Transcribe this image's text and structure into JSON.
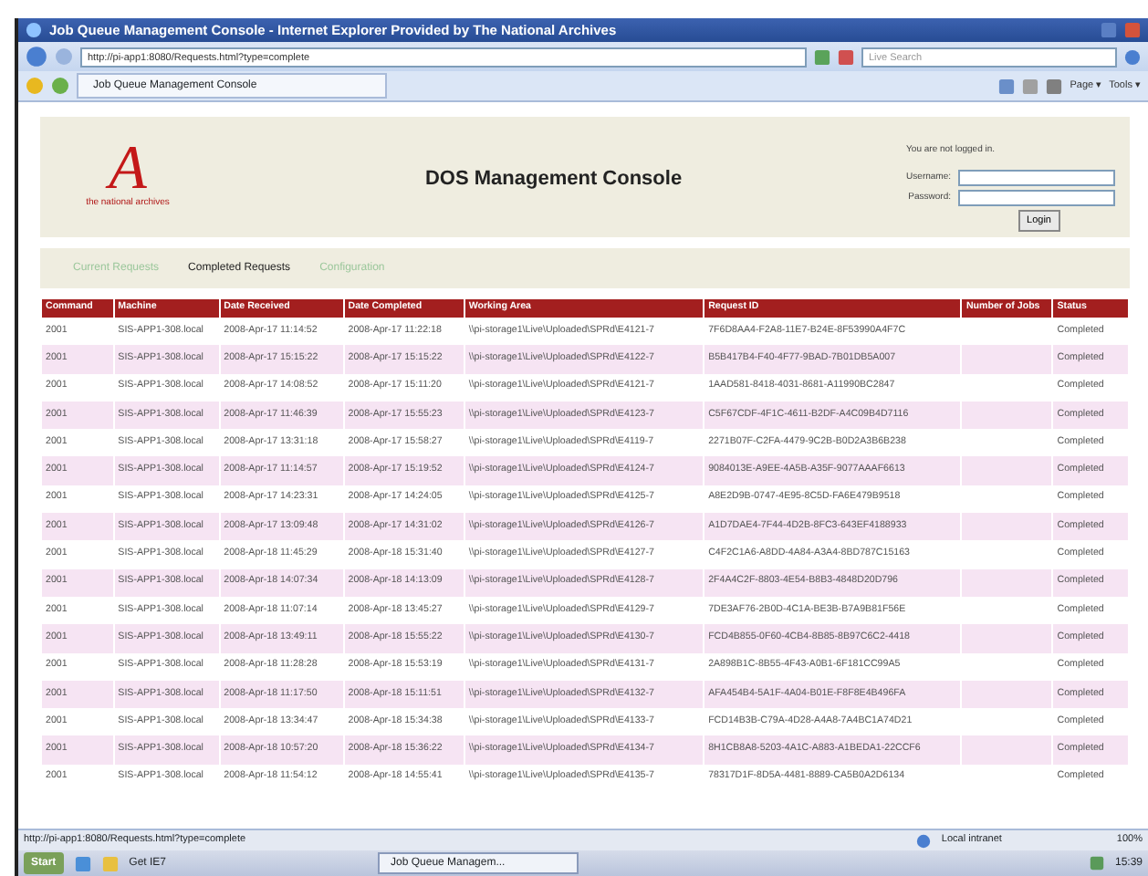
{
  "window": {
    "title": "Job Queue Management Console - Internet Explorer Provided by The National Archives"
  },
  "address_bar": {
    "url": "http://pi-app1:8080/Requests.html?type=complete",
    "search_placeholder": "Live Search"
  },
  "browser_tab": {
    "title": "Job Queue Management Console"
  },
  "command_bar": [
    "Page ▾",
    "Tools ▾"
  ],
  "header": {
    "logo_letter": "A",
    "logo_caption": "the national archives",
    "title": "DOS Management Console",
    "login": {
      "note": "You are not logged in.",
      "username_label": "Username:",
      "password_label": "Password:",
      "button": "Login"
    }
  },
  "nav": [
    {
      "label": "Current Requests",
      "selected": false
    },
    {
      "label": "Completed Requests",
      "selected": true
    },
    {
      "label": "Configuration",
      "selected": false
    }
  ],
  "table": {
    "columns": [
      "Command",
      "Machine",
      "Date Received",
      "Date Completed",
      "Working Area",
      "Request ID",
      "Number of Jobs",
      "Status"
    ],
    "rows": [
      [
        "2001",
        "SIS-APP1-308.local",
        "2008-Apr-17 11:14:52",
        "2008-Apr-17 11:22:18",
        "\\\\pi-storage1\\Live\\Uploaded\\SPRd\\E4121-7",
        "7F6D8AA4-F2A8-11E7-B24E-8F53990A4F7C",
        "",
        "Completed"
      ],
      [
        "2001",
        "SIS-APP1-308.local",
        "2008-Apr-17 15:15:22",
        "2008-Apr-17 15:15:22",
        "\\\\pi-storage1\\Live\\Uploaded\\SPRd\\E4122-7",
        "B5B417B4-F40-4F77-9BAD-7B01DB5A007",
        "",
        "Completed"
      ],
      [
        "2001",
        "SIS-APP1-308.local",
        "2008-Apr-17 14:08:52",
        "2008-Apr-17 15:11:20",
        "\\\\pi-storage1\\Live\\Uploaded\\SPRd\\E4121-7",
        "1AAD581-8418-4031-8681-A11990BC2847",
        "",
        "Completed"
      ],
      [
        "2001",
        "SIS-APP1-308.local",
        "2008-Apr-17 11:46:39",
        "2008-Apr-17 15:55:23",
        "\\\\pi-storage1\\Live\\Uploaded\\SPRd\\E4123-7",
        "C5F67CDF-4F1C-4611-B2DF-A4C09B4D7116",
        "",
        "Completed"
      ],
      [
        "2001",
        "SIS-APP1-308.local",
        "2008-Apr-17 13:31:18",
        "2008-Apr-17 15:58:27",
        "\\\\pi-storage1\\Live\\Uploaded\\SPRd\\E4119-7",
        "2271B07F-C2FA-4479-9C2B-B0D2A3B6B238",
        "",
        "Completed"
      ],
      [
        "2001",
        "SIS-APP1-308.local",
        "2008-Apr-17 11:14:57",
        "2008-Apr-17 15:19:52",
        "\\\\pi-storage1\\Live\\Uploaded\\SPRd\\E4124-7",
        "9084013E-A9EE-4A5B-A35F-9077AAAF6613",
        "",
        "Completed"
      ],
      [
        "2001",
        "SIS-APP1-308.local",
        "2008-Apr-17 14:23:31",
        "2008-Apr-17 14:24:05",
        "\\\\pi-storage1\\Live\\Uploaded\\SPRd\\E4125-7",
        "A8E2D9B-0747-4E95-8C5D-FA6E479B9518",
        "",
        "Completed"
      ],
      [
        "2001",
        "SIS-APP1-308.local",
        "2008-Apr-17 13:09:48",
        "2008-Apr-17 14:31:02",
        "\\\\pi-storage1\\Live\\Uploaded\\SPRd\\E4126-7",
        "A1D7DAE4-7F44-4D2B-8FC3-643EF4188933",
        "",
        "Completed"
      ],
      [
        "2001",
        "SIS-APP1-308.local",
        "2008-Apr-18 11:45:29",
        "2008-Apr-18 15:31:40",
        "\\\\pi-storage1\\Live\\Uploaded\\SPRd\\E4127-7",
        "C4F2C1A6-A8DD-4A84-A3A4-8BD787C15163",
        "",
        "Completed"
      ],
      [
        "2001",
        "SIS-APP1-308.local",
        "2008-Apr-18 14:07:34",
        "2008-Apr-18 14:13:09",
        "\\\\pi-storage1\\Live\\Uploaded\\SPRd\\E4128-7",
        "2F4A4C2F-8803-4E54-B8B3-4848D20D796",
        "",
        "Completed"
      ],
      [
        "2001",
        "SIS-APP1-308.local",
        "2008-Apr-18 11:07:14",
        "2008-Apr-18 13:45:27",
        "\\\\pi-storage1\\Live\\Uploaded\\SPRd\\E4129-7",
        "7DE3AF76-2B0D-4C1A-BE3B-B7A9B81F56E",
        "",
        "Completed"
      ],
      [
        "2001",
        "SIS-APP1-308.local",
        "2008-Apr-18 13:49:11",
        "2008-Apr-18 15:55:22",
        "\\\\pi-storage1\\Live\\Uploaded\\SPRd\\E4130-7",
        "FCD4B855-0F60-4CB4-8B85-8B97C6C2-4418",
        "",
        "Completed"
      ],
      [
        "2001",
        "SIS-APP1-308.local",
        "2008-Apr-18 11:28:28",
        "2008-Apr-18 15:53:19",
        "\\\\pi-storage1\\Live\\Uploaded\\SPRd\\E4131-7",
        "2A898B1C-8B55-4F43-A0B1-6F181CC99A5",
        "",
        "Completed"
      ],
      [
        "2001",
        "SIS-APP1-308.local",
        "2008-Apr-18 11:17:50",
        "2008-Apr-18 15:11:51",
        "\\\\pi-storage1\\Live\\Uploaded\\SPRd\\E4132-7",
        "AFA454B4-5A1F-4A04-B01E-F8F8E4B496FA",
        "",
        "Completed"
      ],
      [
        "2001",
        "SIS-APP1-308.local",
        "2008-Apr-18 13:34:47",
        "2008-Apr-18 15:34:38",
        "\\\\pi-storage1\\Live\\Uploaded\\SPRd\\E4133-7",
        "FCD14B3B-C79A-4D28-A4A8-7A4BC1A74D21",
        "",
        "Completed"
      ],
      [
        "2001",
        "SIS-APP1-308.local",
        "2008-Apr-18 10:57:20",
        "2008-Apr-18 15:36:22",
        "\\\\pi-storage1\\Live\\Uploaded\\SPRd\\E4134-7",
        "8H1CB8A8-5203-4A1C-A883-A1BEDA1-22CCF6",
        "",
        "Completed"
      ],
      [
        "2001",
        "SIS-APP1-308.local",
        "2008-Apr-18 11:54:12",
        "2008-Apr-18 14:55:41",
        "\\\\pi-storage1\\Live\\Uploaded\\SPRd\\E4135-7",
        "78317D1F-8D5A-4481-8889-CA5B0A2D6134",
        "",
        "Completed"
      ]
    ]
  },
  "status_bar": {
    "url": "http://pi-app1:8080/Requests.html?type=complete",
    "zone": "Local intranet",
    "zoom": "100%"
  },
  "taskbar": {
    "start": "Start",
    "quick_launch": "Get IE7",
    "task": "Job Queue Managem...",
    "clock": "15:39"
  }
}
